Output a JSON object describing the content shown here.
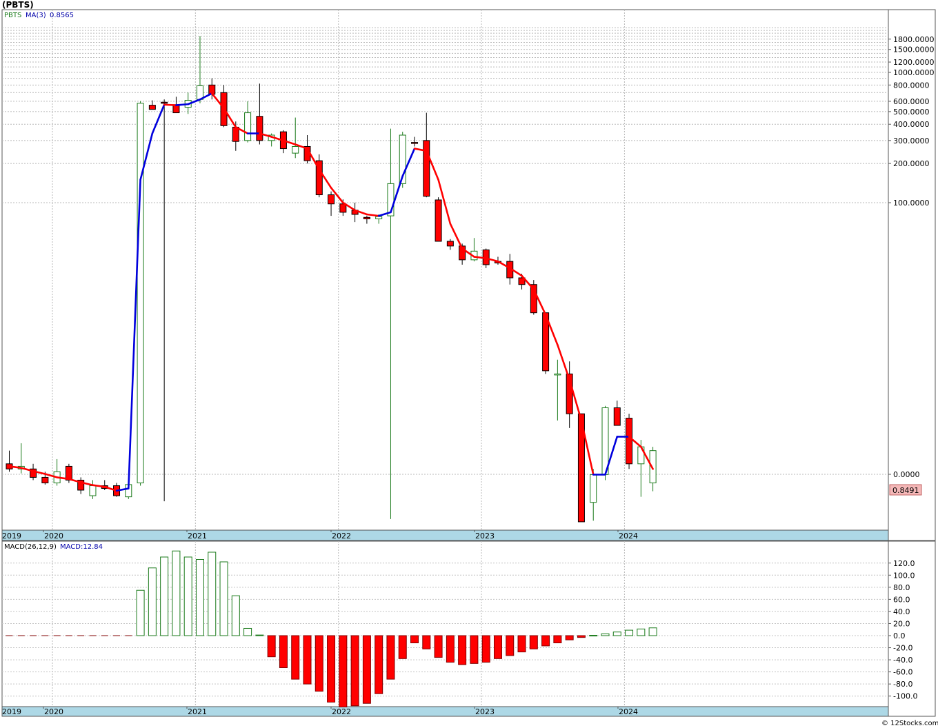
{
  "title": "(PBTS)",
  "watermark": "© 12Stocks.com",
  "legend": {
    "symbol": "PBTS",
    "ma_label": "MA(3)",
    "ma_value": "0.8565"
  },
  "last_price_label": "0.8491",
  "macd_legend": {
    "label": "MACD(26,12,9)",
    "value_label": "MACD:12.84"
  },
  "colors": {
    "up": "#1a7a1a",
    "down": "#ff0000",
    "ma_up": "#0000dd",
    "ma_down": "#ff0000",
    "axis_band": "#add8e6",
    "price_tag": "#f4b8b8"
  },
  "chart_data": [
    {
      "type": "candlestick",
      "scale": "log",
      "frequency": "monthly",
      "y_ticks": [
        "0.0000",
        "100.0000",
        "200.0000",
        "300.0000",
        "400.0000",
        "500.0000",
        "600.0000",
        "800.0000",
        "1000.0000",
        "1200.0000",
        "1500.0000",
        "1800.0000"
      ],
      "x_labels": [
        "2019",
        "2020",
        "2021",
        "2022",
        "2023",
        "2024"
      ],
      "grid": true,
      "ohlc": [
        [
          1.2,
          1.5,
          1.05,
          1.1
        ],
        [
          1.1,
          1.7,
          1.02,
          1.15
        ],
        [
          1.1,
          1.2,
          0.9,
          0.95
        ],
        [
          0.95,
          1.05,
          0.82,
          0.85
        ],
        [
          0.85,
          1.3,
          0.8,
          1.05
        ],
        [
          1.15,
          1.2,
          0.85,
          0.9
        ],
        [
          0.9,
          0.95,
          0.65,
          0.72
        ],
        [
          0.62,
          0.9,
          0.56,
          0.8
        ],
        [
          0.8,
          0.9,
          0.72,
          0.75
        ],
        [
          0.8,
          0.85,
          0.6,
          0.62
        ],
        [
          0.6,
          0.85,
          0.56,
          0.82
        ],
        [
          0.85,
          600,
          0.8,
          580
        ],
        [
          560,
          610,
          520,
          520
        ],
        [
          590,
          620,
          0.52,
          580
        ],
        [
          565,
          650,
          490,
          490
        ],
        [
          540,
          700,
          480,
          610
        ],
        [
          620,
          1900,
          580,
          790
        ],
        [
          800,
          900,
          620,
          680
        ],
        [
          700,
          800,
          380,
          390
        ],
        [
          380,
          420,
          250,
          295
        ],
        [
          300,
          600,
          290,
          490
        ],
        [
          460,
          820,
          280,
          300
        ],
        [
          300,
          340,
          270,
          330
        ],
        [
          350,
          360,
          240,
          260
        ],
        [
          240,
          450,
          220,
          270
        ],
        [
          270,
          330,
          200,
          210
        ],
        [
          210,
          235,
          110,
          115
        ],
        [
          115,
          122,
          80,
          98
        ],
        [
          98,
          106,
          80,
          85
        ],
        [
          88,
          100,
          72,
          82
        ],
        [
          78,
          80,
          70,
          76
        ],
        [
          76,
          82,
          70,
          79
        ],
        [
          80,
          370,
          0.2,
          140
        ],
        [
          140,
          350,
          130,
          330
        ],
        [
          290,
          320,
          270,
          285
        ],
        [
          300,
          490,
          110,
          112
        ],
        [
          105,
          110,
          52,
          52
        ],
        [
          52,
          54,
          45,
          48
        ],
        [
          48,
          50,
          35,
          38
        ],
        [
          38,
          55,
          37,
          44
        ],
        [
          45,
          46,
          33,
          35
        ],
        [
          37,
          40,
          35,
          36
        ],
        [
          37,
          42,
          25,
          28
        ],
        [
          28,
          30,
          23,
          25
        ],
        [
          25,
          27,
          15,
          15.5
        ],
        [
          15.5,
          15.6,
          5.5,
          5.8
        ],
        [
          5.5,
          7,
          2.5,
          5.5
        ],
        [
          5.5,
          6.8,
          2.2,
          2.8
        ],
        [
          2.8,
          2.8,
          0.15,
          0.15
        ],
        [
          0.5,
          1.1,
          0.17,
          1.0
        ],
        [
          1.0,
          3.2,
          0.9,
          3.1
        ],
        [
          3.1,
          3.5,
          2.3,
          2.3
        ],
        [
          2.6,
          2.8,
          1.1,
          1.2
        ],
        [
          1.2,
          1.8,
          0.6,
          1.6
        ],
        [
          0.85,
          1.6,
          0.7,
          1.5
        ]
      ],
      "ma3": [
        1.15,
        1.12,
        1.06,
        1.01,
        0.95,
        0.92,
        0.86,
        0.81,
        0.78,
        0.71,
        0.75,
        150,
        340,
        565,
        560,
        570,
        620,
        690,
        530,
        380,
        340,
        340,
        320,
        300,
        280,
        260,
        180,
        130,
        100,
        88,
        82,
        80,
        85,
        160,
        260,
        250,
        150,
        70,
        46,
        40,
        39,
        37,
        33,
        29,
        23,
        15,
        9,
        5,
        2.5,
        1.0,
        1.0,
        1.9,
        1.9,
        1.6,
        1.1
      ]
    },
    {
      "type": "bar",
      "title": "MACD(26,12,9)",
      "y_ticks": [
        "120.0",
        "100.0",
        "80.0",
        "60.0",
        "40.0",
        "20.0",
        "0.0",
        "-20.0",
        "-40.0",
        "-60.0",
        "-80.0",
        "-100.0"
      ],
      "x_labels": [
        "2019",
        "2020",
        "2021",
        "2022",
        "2023",
        "2024"
      ],
      "grid": true,
      "values": [
        0,
        0,
        0,
        0,
        0,
        0,
        0,
        0,
        0,
        0,
        0,
        75,
        112,
        130,
        140,
        130,
        126,
        138,
        122,
        66,
        12,
        1,
        -35,
        -53,
        -72,
        -80,
        -92,
        -110,
        -118,
        -116,
        -112,
        -96,
        -72,
        -38,
        -12,
        -22,
        -36,
        -44,
        -48,
        -46,
        -44,
        -38,
        -33,
        -27,
        -22,
        -17,
        -12,
        -7,
        -3,
        0.5,
        3,
        6,
        9,
        11,
        12.84
      ]
    }
  ]
}
